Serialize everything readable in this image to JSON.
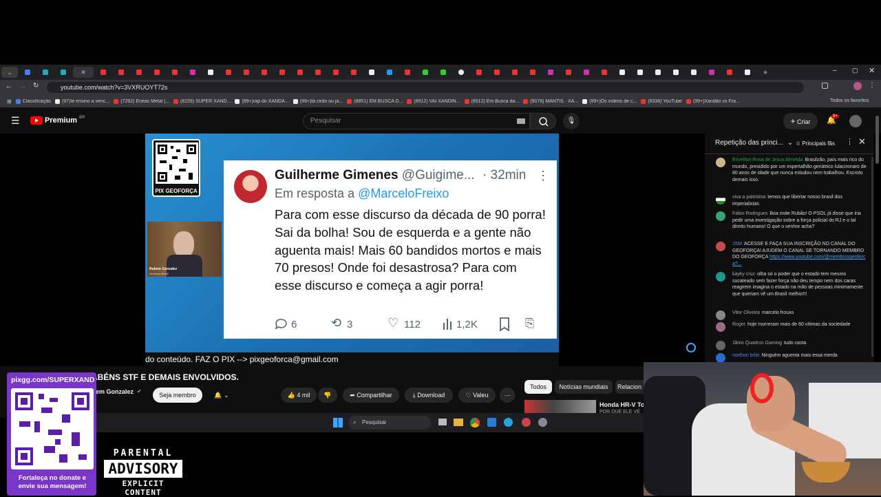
{
  "browser": {
    "url": "youtube.com/watch?v=3VXRUOYT72s",
    "bookmarks": [
      "Classificação",
      "(97)Ie ensino a venc...",
      "(7292) Enéas Metal |...",
      "(8159) SUPER XAND...",
      "(99+)rap do XANDÃ...",
      "(99+)tá cedo ou já...",
      "(8851) EM BUSCA D...",
      "(8912) VAI XANDIN...",
      "(8912) Em Busca da...",
      "(9078) MANTIS · XA...",
      "(99+)Os vídeos de c...",
      "(9338) YouTube",
      "(99+)Xandão vs Fra..."
    ],
    "all_bookmarks": "Todos os favoritos"
  },
  "youtube": {
    "logo": "Premium",
    "region": "BR",
    "search_placeholder": "Pesquisar",
    "create_label": "Criar",
    "notif_count": "9+"
  },
  "video": {
    "qr_label": "PIX GEOFORÇA",
    "presenter_name": "Rubem Gonzalez",
    "presenter_sub": "Geoforça Brasil",
    "caption": "do conteúdo. FAZ O PIX --> pixgeoforca@gmail.com"
  },
  "tweet": {
    "name": "Guilherme Gimenes",
    "handle": "@Guigime...",
    "time": "· 32min",
    "reply_prefix": "Em resposta a",
    "reply_to": "@MarceloFreixo",
    "text": "Para com esse discurso da década de 90 porra! Sai da bolha! Sou de esquerda e a gente não aguenta mais! Mais 60 bandidos mortos e mais 70 presos! Onde foi desastrosa? Para com esse discurso e começa a agir porra!",
    "replies": "6",
    "retweets": "3",
    "likes": "112",
    "views": "1,2K"
  },
  "below": {
    "title": "ABÉNS STF E DEMAIS ENVOLVIDOS.",
    "channel": "em Gonzalez",
    "join": "Seja membro",
    "likes": "4 mil",
    "share": "Compartilhar",
    "download": "Download",
    "thanks": "Valeu",
    "chips": [
      "Todos",
      "Notícias mundiais",
      "Relacion"
    ],
    "rec_title": "Honda HR-V Tour",
    "rec_sub": "POR QUE ELE VE"
  },
  "chat": {
    "header": "Repetição das princi...",
    "badge": "Principais fãs",
    "messages": [
      {
        "author": "Erivelton Rosa de Jesus Almeida",
        "text": "Brasilzão, país mais rico do mundo, presidido por um espertalhão geriátrico lulacironaro de 80 anos de idade que nunca estudou nem trabalhou. Escroto demais isso.",
        "color": "#c9b88a"
      },
      {
        "author": "viva a palestina",
        "text": "temos que libertar nosso brasil dos imperialistas",
        "color": "#3a7a3a"
      },
      {
        "author": "Fabio Rodrigues",
        "text": "Boa noite Rubão! O PSOL já disse que iria pedir uma investigação sobre a força policial do RJ e o tal direito humano! O que o senhor acha?",
        "color": "#3aa37a"
      },
      {
        "author": "JSM",
        "text": "ACESSE E FAÇA SUA INSCRIÇÃO NO CANAL DO GEOFORÇA! AJUDEM O CANAL SE TORNANDO MEMBRO DO GEOFORÇA",
        "link": "https://www.youtube.com/@membrosgeoforca?...",
        "color": "#c94a4a"
      },
      {
        "author": "kayky cruz",
        "text": "olha só o poder que o estado tem mesmo sucateado sem fazer força não deu tempo nem dos caras reagirem imagina o estado na mão de pessoas minimamente que queriam vê um Brasil melhor!!!",
        "color": "#1a9a8a"
      },
      {
        "author": "Vitor Oliveira",
        "text": "marcelo frouxo",
        "color": "#888"
      },
      {
        "author": "Roger",
        "text": "hoje morreram mais de 60 vítimas da sociedade",
        "color": "#9a6a8a"
      },
      {
        "author": "Jânio Quadros Gaming",
        "text": "tudo casta",
        "color": "#666"
      },
      {
        "author": "northon brito",
        "text": "Ninguém aguenta mais essa merda",
        "color": "#2a6acf"
      }
    ]
  },
  "overlay": {
    "pix_url": "pixgg.com/SUPERXAND",
    "pix_msg": "Fortaleça no donate e envie sua mensagem!",
    "advisory_top": "PARENTAL",
    "advisory_mid": "ADVISORY",
    "advisory_bot": "EXPLICIT CONTENT"
  },
  "taskbar": {
    "search": "Pesquisar"
  }
}
